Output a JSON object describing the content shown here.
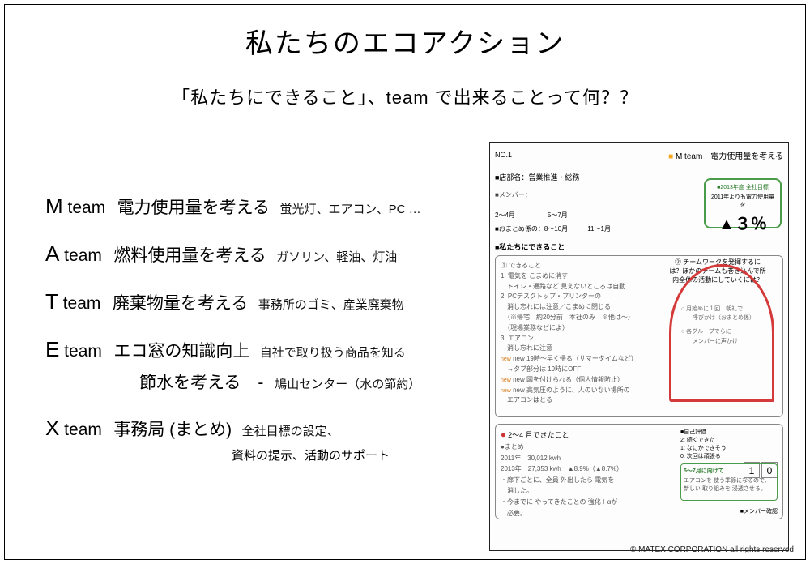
{
  "title": "私たちのエコアクション",
  "subtitle": "「私たちにできること」、team で出来ることって何？？",
  "teams": [
    {
      "letter": "M",
      "label": " team",
      "topic": "電力使用量を考える",
      "detail": "蛍光灯、エアコン、PC …"
    },
    {
      "letter": "A",
      "label": " team",
      "topic": "燃料使用量を考える",
      "detail": "ガソリン、軽油、灯油"
    },
    {
      "letter": "T",
      "label": " team",
      "topic": "廃棄物量を考える",
      "detail": "事務所のゴミ、産業廃棄物"
    },
    {
      "letter": "E",
      "label": " team",
      "topic": "エコ窓の知識向上",
      "detail": "自社で取り扱う商品を知る",
      "extra_topic": "節水を考える　-",
      "extra_detail": "鳩山センター（水の節約）"
    },
    {
      "letter": "X",
      "label": " team",
      "topic": "事務局 (まとめ)",
      "detail": "全社目標の設定、",
      "extra_sub": "資料の提示、活動のサポート"
    }
  ],
  "worksheet": {
    "no": "NO.1",
    "team_badge": "M team　電力使用量を考える",
    "dept_label": "■店部名：営業推進・総務",
    "goal_year": "■2013年度 全社目標",
    "goal_text": "2011年よりも電力使用量を",
    "goal_pct": "▲３％",
    "members_label": "■メンバー：",
    "period1": "2～4月",
    "period2": "5～7月",
    "summary_label": "■おまとめ係の：8～10月",
    "summary_label2": "11～1月",
    "section1": "■私たちにできること",
    "q1": "① できること",
    "q2": "② チームワークを発揮するには？ほかのチームも巻き込んで所内全体の活動にしていくには？",
    "left_lines": [
      "1. 電気を こまめに消す",
      "　トイレ・通路など 見えないところは自動",
      "2. PCデスクトップ・プリンターの",
      "　消し忘れには注意／こまめに閉じる",
      "　（※帰宅　約20分前　本社のみ　※他は～）",
      "　（現場業務などによ）",
      "3. エアコン",
      "　消し忘れに注意",
      "new 19時～早く帰る（サマータイムなど）",
      "　→タブ部分は 19時にOFF",
      "new 図を付けられる（個人情報防止）",
      "new 高気圧のように、人のいない場所の",
      "　エアコンはとる"
    ],
    "circle_lines": [
      "○ 月始めに１回　朝礼で",
      "　　呼びかけ（おまとめ係）",
      "○ 各グループでらに",
      "　　メンバーに声かけ"
    ],
    "section2_title": "2～4 月できたこと",
    "section2_sub": "●まとめ",
    "bottom_lines": [
      "2011年　30,012 kwh",
      "2013年　27,353 kwh　▲8.9%（▲8.7%）",
      "・廊下ごとに、全員 外出したら 電気を",
      "　消した。",
      "・今までに やってきたことの 強化＋αが",
      "　必要。"
    ],
    "self_eval_label": "■自己評価",
    "self_eval_opts": [
      "2: 続くできた",
      "1: なにかできそう",
      "0: 次回は頑張る"
    ],
    "self_eval_vals": [
      "1",
      "0"
    ],
    "next_label": "5～7月に向けて",
    "next_text": "エアコンを 使う季節になるので、新しい 取り組みを 浸透させる。",
    "member_sig": "■メンバー確認",
    "copyright": "© MATEX CORPORATION all rights reserved"
  }
}
